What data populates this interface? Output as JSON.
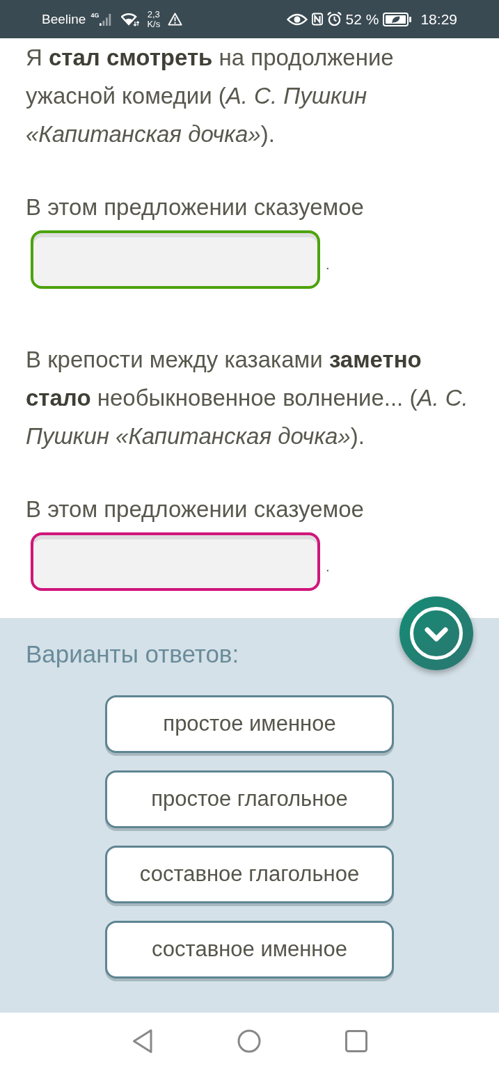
{
  "status_bar": {
    "carrier": "Beeline",
    "network": "4G",
    "speed": "2,3",
    "speed_unit": "K/s",
    "battery": "52 %",
    "time": "18:29"
  },
  "exercise": [
    {
      "sentence": "Я **стал смотреть** на продолжение ужасной комедии (*А. С. Пушкин «Капитанская дочка»*).",
      "prompt": "В этом предложении сказуемое",
      "answer_box": {
        "color": "#4ca30d"
      },
      "end_mark": "."
    },
    {
      "sentence": "В крепости между казаками **заметно стало** необыкновенное волнение... (*А. С. Пушкин «Капитанская дочка»*).",
      "prompt": "В этом предложении сказуемое",
      "answer_box": {
        "color": "#d0157a"
      },
      "end_mark": "."
    }
  ],
  "answer_options": {
    "title": "Варианты ответов:",
    "options": [
      "простое именное",
      "простое глагольное",
      "составное глагольное",
      "составное именное"
    ]
  }
}
